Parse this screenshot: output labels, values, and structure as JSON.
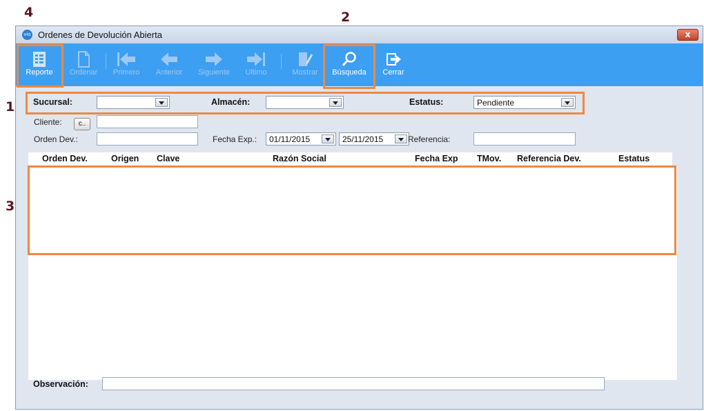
{
  "callouts": {
    "c1": "1",
    "c2": "2",
    "c3": "3",
    "c4": "4"
  },
  "window": {
    "title": "Ordenes de Devolución Abierta",
    "app_icon": "vio",
    "close": "x"
  },
  "toolbar": {
    "reporte": "Reporte",
    "ordenar": "Ordenar",
    "primero": "Primero",
    "anterior": "Anterior",
    "siguiente": "Siguiente",
    "ultimo": "Ultimo",
    "mostrar": "Mostrar",
    "busqueda": "Búsqueda",
    "cerrar": "Cerrar"
  },
  "filters": {
    "sucursal_label": "Sucursal:",
    "sucursal_value": "",
    "almacen_label": "Almacén:",
    "almacen_value": "",
    "estatus_label": "Estatus:",
    "estatus_value": "Pendiente"
  },
  "search": {
    "cliente_label": "Cliente:",
    "cliente_btn": "c..",
    "orden_label": "Orden Dev.:",
    "fecha_label": "Fecha Exp.:",
    "fecha_desde": "01/11/2015",
    "fecha_hasta": "25/11/2015",
    "referencia_label": "Referencia:"
  },
  "grid": {
    "columns": [
      "Orden Dev.",
      "Origen",
      "Clave",
      "Razón Social",
      "Fecha Exp",
      "TMov.",
      "Referencia Dev.",
      "Estatus"
    ]
  },
  "footer": {
    "observacion_label": "Observación:"
  },
  "colors": {
    "toolbar": "#3c9ff2",
    "highlight": "#f0883d",
    "callout": "#5a1620",
    "window_bg": "#dfe6ef"
  }
}
